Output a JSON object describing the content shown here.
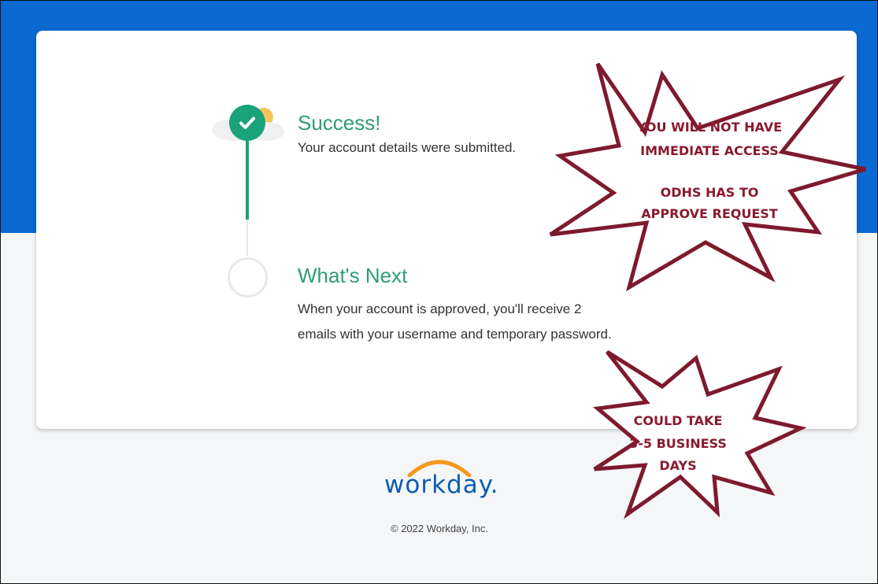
{
  "success": {
    "title": "Success!",
    "message": "Your account details were submitted."
  },
  "next": {
    "title": "What's Next",
    "line1": "When your account is approved, you'll receive 2",
    "line2": "emails with your username and temporary password."
  },
  "footer": {
    "logo_text": "workday.",
    "copyright": "© 2022 Workday, Inc."
  },
  "callouts": {
    "top": {
      "line1": "YOU WILL NOT HAVE",
      "line2": "IMMEDIATE ACCESS",
      "line3": "ODHS HAS TO",
      "line4": "APPROVE REQUEST"
    },
    "bottom": {
      "line1": "COULD TAKE",
      "line2": "3-5 BUSINESS",
      "line3": "DAYS"
    }
  },
  "colors": {
    "header_blue": "#0a6ad1",
    "success_green": "#1aa37a",
    "callout_red": "#8a1a2e",
    "logo_orange": "#f29a1d"
  }
}
